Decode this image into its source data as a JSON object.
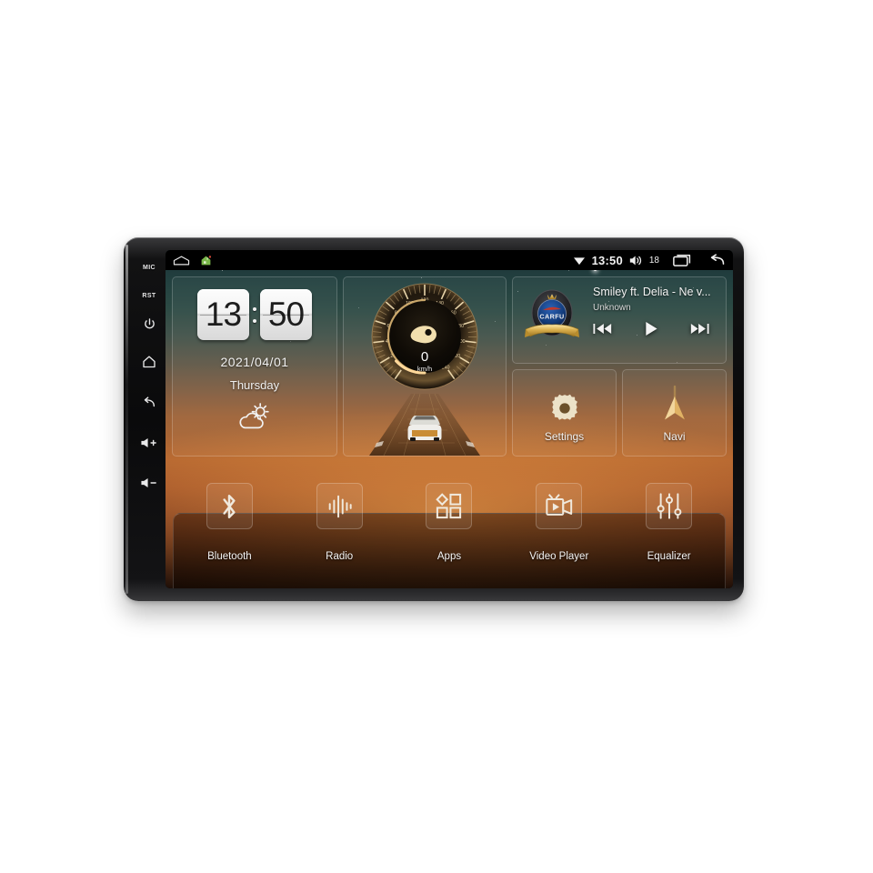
{
  "device": {
    "bezel_buttons": [
      {
        "name": "mic",
        "label": "MIC",
        "type": "text"
      },
      {
        "name": "reset",
        "label": "RST",
        "type": "text"
      },
      {
        "name": "power",
        "label": "",
        "type": "icon"
      },
      {
        "name": "home",
        "label": "",
        "type": "icon"
      },
      {
        "name": "back",
        "label": "",
        "type": "icon"
      },
      {
        "name": "volume-up",
        "label": "",
        "type": "icon"
      },
      {
        "name": "volume-down",
        "label": "",
        "type": "icon"
      }
    ]
  },
  "statusbar": {
    "left_icons": [
      "home-outline-icon",
      "green-house-app-icon"
    ],
    "wifi_icon": "wifi-icon",
    "time": "13:50",
    "volume_icon": "volume-icon",
    "volume_level": "18",
    "recents_icon": "recent-apps-icon",
    "back_icon": "back-arrow-icon"
  },
  "clock_widget": {
    "hours": "13",
    "minutes": "50",
    "date": "2021/04/01",
    "weekday": "Thursday",
    "weather_icon": "sun-behind-cloud-icon"
  },
  "speedometer_widget": {
    "value": "0",
    "unit": "km/h",
    "ticks": [
      "0",
      "20",
      "40",
      "60",
      "80",
      "100",
      "120",
      "140",
      "160",
      "180",
      "200",
      "220",
      "240"
    ],
    "min": 0,
    "max": 240,
    "accent_color": "#d9a860"
  },
  "media_widget": {
    "album_art_text": "CARFU",
    "title": "Smiley ft. Delia - Ne v...",
    "artist": "Unknown",
    "prev_icon": "skip-previous-icon",
    "play_icon": "play-icon",
    "next_icon": "skip-next-icon"
  },
  "tiles": [
    {
      "name": "settings",
      "label": "Settings",
      "icon": "gear-icon"
    },
    {
      "name": "navi",
      "label": "Navi",
      "icon": "navigation-arrow-icon"
    }
  ],
  "dock": [
    {
      "name": "bluetooth",
      "label": "Bluetooth",
      "icon": "bluetooth-icon"
    },
    {
      "name": "radio",
      "label": "Radio",
      "icon": "radio-waveform-icon"
    },
    {
      "name": "apps",
      "label": "Apps",
      "icon": "apps-grid-icon"
    },
    {
      "name": "video-player",
      "label": "Video Player",
      "icon": "video-camera-icon"
    },
    {
      "name": "equalizer",
      "label": "Equalizer",
      "icon": "equalizer-sliders-icon"
    }
  ],
  "colors": {
    "accent_gold": "#d9a860",
    "sky_top": "#1d3238",
    "sunset": "#b3642f",
    "text": "#f2f2f2"
  }
}
